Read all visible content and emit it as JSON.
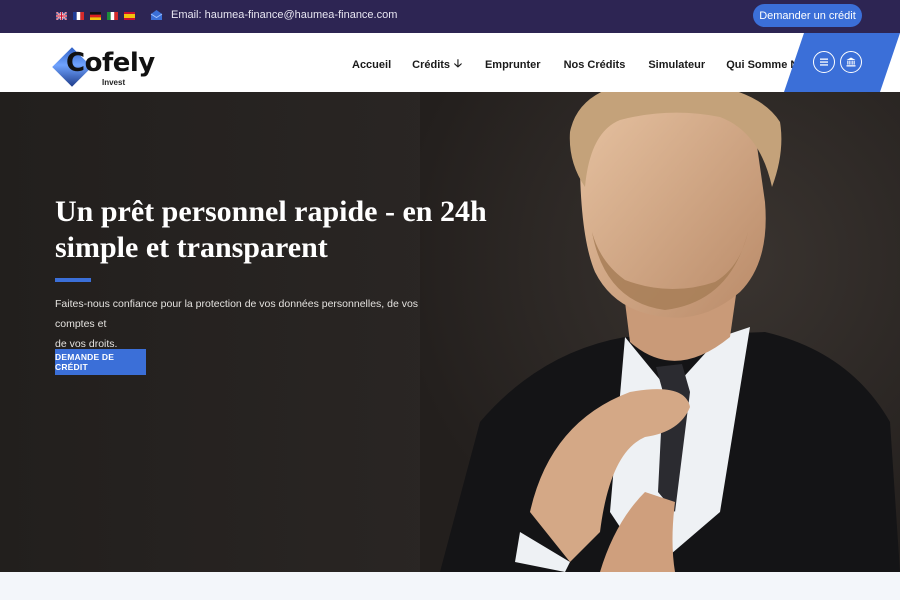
{
  "topbar": {
    "flags": [
      {
        "name": "flag-uk-icon",
        "label": "English"
      },
      {
        "name": "flag-fr-icon",
        "label": "Français"
      },
      {
        "name": "flag-de-icon",
        "label": "Deutsch"
      },
      {
        "name": "flag-it-icon",
        "label": "Italiano"
      },
      {
        "name": "flag-es-icon",
        "label": "Español"
      }
    ],
    "email_label": "Email: haumea-finance@haumea-finance.com",
    "email_icon": "envelope-icon",
    "cta_label": "Demander un crédit"
  },
  "header": {
    "logo_word": "Cofely",
    "logo_sub": "Invest",
    "nav": [
      {
        "label": "Accueil"
      },
      {
        "label": "Crédits",
        "icon": "arrow-down-icon"
      },
      {
        "label": "Emprunter"
      },
      {
        "label": "Nos Crédits"
      },
      {
        "label": "Simulateur"
      },
      {
        "label": "Qui Somme Nous ?"
      }
    ],
    "menu_icon": "menu-lines-icon",
    "bank_icon": "bank-icon"
  },
  "hero": {
    "title_line1": "Un prêt personnel rapide - en 24h",
    "title_line2": "simple et transparent",
    "text_line1": "Faites-nous confiance pour la protection de vos données personnelles, de vos comptes et",
    "text_line2": "de vos droits.",
    "button_label": "DEMANDE DE CRÉDIT"
  },
  "colors": {
    "topbar": "#2d2553",
    "accent": "#3b6fd8",
    "hero_bg": "#221f1d"
  }
}
